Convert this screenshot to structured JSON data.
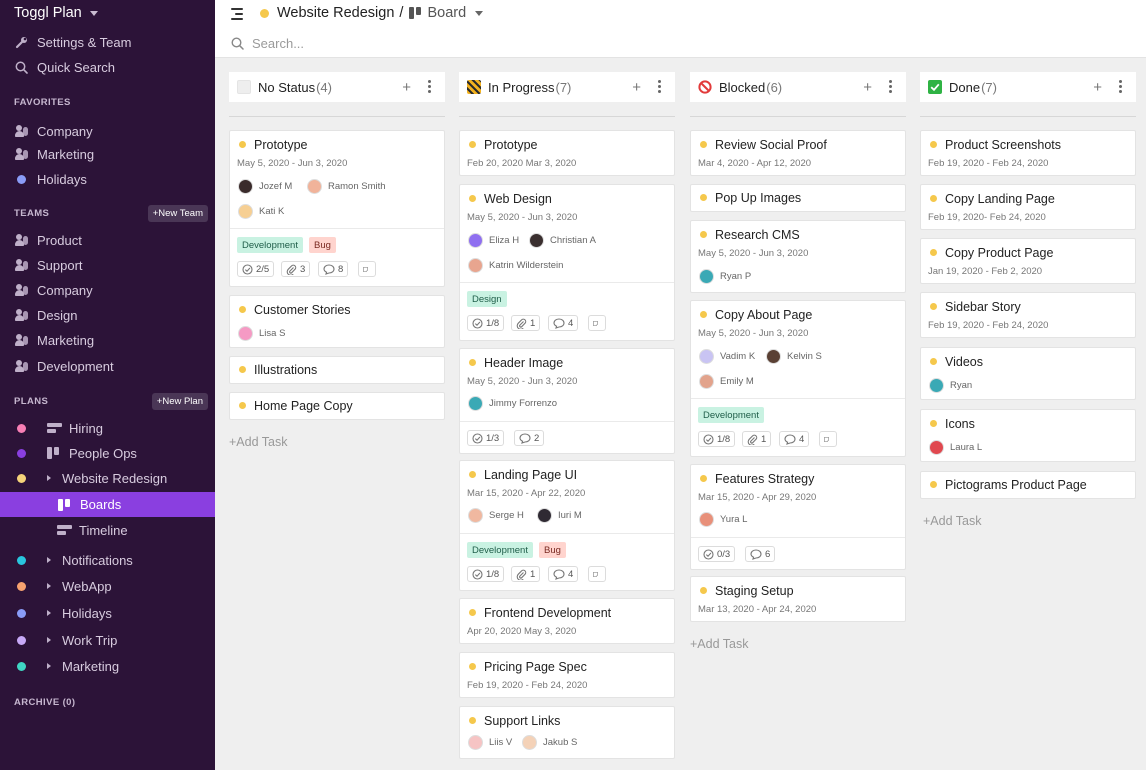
{
  "app": {
    "title": "Toggl Plan"
  },
  "sidebar": {
    "settings": "Settings & Team",
    "quick_search": "Quick Search",
    "favorites_header": "FAVORITES",
    "favorites": [
      "Company",
      "Marketing",
      "Holidays"
    ],
    "teams_header": "TEAMS",
    "new_team": "+New Team",
    "teams": [
      "Product",
      "Support",
      "Company",
      "Design",
      "Marketing",
      "Development"
    ],
    "plans_header": "PLANS",
    "new_plan": "+New Plan",
    "plans": [
      {
        "label": "Hiring",
        "color": "#f77fb5"
      },
      {
        "label": "People Ops",
        "color": "#8a3fe0"
      },
      {
        "label": "Website Redesign",
        "color": "#f5d37a"
      }
    ],
    "website_children": [
      "Boards",
      "Timeline"
    ],
    "more_plans": [
      {
        "label": "Notifications",
        "color": "#29c6de"
      },
      {
        "label": "WebApp",
        "color": "#f7a26f"
      },
      {
        "label": "Holidays",
        "color": "#8a9cf7"
      },
      {
        "label": "Work Trip",
        "color": "#c7a9f7"
      },
      {
        "label": "Marketing",
        "color": "#3fd6c3"
      }
    ],
    "archive": "ARCHIVE (0)"
  },
  "topbar": {
    "project": "Website Redesign",
    "separator": "/",
    "view": "Board",
    "search_placeholder": "Search..."
  },
  "board": {
    "add_task": "+Add Task",
    "columns": [
      {
        "name": "No Status",
        "count": "(4)",
        "cards": [
          {
            "title": "Prototype",
            "date": "May 5, 2020 - Jun 3, 2020",
            "people": [
              "Jozef M",
              "Ramon Smith",
              "Kati K"
            ],
            "tags": [
              "Development",
              "Bug"
            ],
            "stats": [
              "2/5",
              "3",
              "8"
            ]
          },
          {
            "title": "Customer Stories",
            "people": [
              "Lisa S"
            ]
          },
          {
            "title": "Illustrations"
          },
          {
            "title": "Home Page Copy"
          }
        ]
      },
      {
        "name": "In Progress",
        "count": "(7)",
        "cards": [
          {
            "title": "Prototype",
            "date": "Feb 20, 2020 Mar 3, 2020"
          },
          {
            "title": "Web Design",
            "date": "May 5, 2020 - Jun 3, 2020",
            "people": [
              "Eliza H",
              "Christian A",
              "Katrin Wilderstein"
            ],
            "tags": [
              "Design"
            ],
            "stats": [
              "1/8",
              "1",
              "4"
            ]
          },
          {
            "title": "Header Image",
            "date": "May 5, 2020 - Jun 3, 2020",
            "people": [
              "Jimmy Forrenzo"
            ],
            "stats": [
              "1/3",
              "2"
            ]
          },
          {
            "title": "Landing Page UI",
            "date": "Mar 15, 2020 - Apr 22, 2020",
            "people": [
              "Serge H",
              "Iuri M"
            ],
            "tags": [
              "Development",
              "Bug"
            ],
            "stats": [
              "1/8",
              "1",
              "4"
            ]
          },
          {
            "title": "Frontend Development",
            "date": "Apr 20, 2020 May 3, 2020"
          },
          {
            "title": "Pricing Page Spec",
            "date": "Feb 19, 2020 - Feb 24, 2020"
          },
          {
            "title": "Support Links",
            "people": [
              "Liis V",
              "Jakub S"
            ]
          }
        ]
      },
      {
        "name": "Blocked",
        "count": "(6)",
        "cards": [
          {
            "title": "Review Social Proof",
            "date": "Mar 4, 2020 - Apr 12, 2020"
          },
          {
            "title": "Pop Up Images"
          },
          {
            "title": "Research CMS",
            "date": "May 5, 2020 - Jun 3, 2020",
            "people": [
              "Ryan P"
            ]
          },
          {
            "title": "Copy About Page",
            "date": "May 5, 2020 - Jun 3, 2020",
            "people": [
              "Vadim K",
              "Kelvin S",
              "Emily M"
            ],
            "tags": [
              "Development"
            ],
            "stats": [
              "1/8",
              "1",
              "4"
            ]
          },
          {
            "title": "Features Strategy",
            "date": "Mar 15, 2020 - Apr 29, 2020",
            "people": [
              "Yura L"
            ],
            "stats": [
              "0/3",
              "6"
            ]
          },
          {
            "title": "Staging Setup",
            "date": "Mar 13, 2020 - Apr 24, 2020"
          }
        ]
      },
      {
        "name": "Done",
        "count": "(7)",
        "cards": [
          {
            "title": "Product Screenshots",
            "date": "Feb 19, 2020 - Feb 24, 2020"
          },
          {
            "title": "Copy Landing Page",
            "date": "Feb 19, 2020- Feb 24, 2020"
          },
          {
            "title": "Copy Product Page",
            "date": "Jan 19, 2020 - Feb 2, 2020"
          },
          {
            "title": "Sidebar Story",
            "date": "Feb 19, 2020 - Feb 24, 2020"
          },
          {
            "title": "Videos",
            "people": [
              "Ryan"
            ]
          },
          {
            "title": "Icons",
            "people": [
              "Laura L"
            ]
          },
          {
            "title": "Pictograms Product Page"
          }
        ]
      }
    ]
  },
  "colors": {
    "sidebar_bg": "#2c1338",
    "active": "#8a3fe0",
    "task_dot": "#f5c84c"
  }
}
